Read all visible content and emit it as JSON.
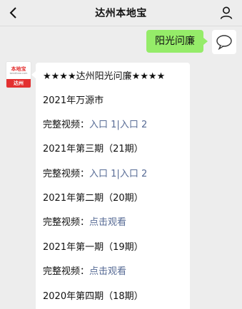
{
  "header": {
    "title": "达州本地宝"
  },
  "outgoing": {
    "text": "阳光问廉"
  },
  "avatar": {
    "brand": "本地宝",
    "sub": "bendibao.com",
    "city": "达州"
  },
  "message": {
    "title": "★★★★达州阳光问廉★★★★",
    "sections": [
      {
        "heading": "2021年万源市",
        "video_label": "完整视频：",
        "links": [
          "入口 1",
          "入口 2"
        ],
        "separator": "|"
      },
      {
        "heading": "2021年第三期（21期）",
        "video_label": "完整视频：",
        "links": [
          "入口 1",
          "入口 2"
        ],
        "separator": "|"
      },
      {
        "heading": "2021年第二期（20期）",
        "video_label": "完整视频：",
        "links": [
          "点击观看"
        ]
      },
      {
        "heading": "2021年第一期（19期）",
        "video_label": "完整视频：",
        "links": [
          "点击观看"
        ]
      },
      {
        "heading": "2020年第四期（18期）"
      }
    ]
  },
  "colors": {
    "background": "#ededed",
    "outgoing_bubble": "#95ec69",
    "link": "#576b95",
    "logo_red": "#e33030"
  }
}
